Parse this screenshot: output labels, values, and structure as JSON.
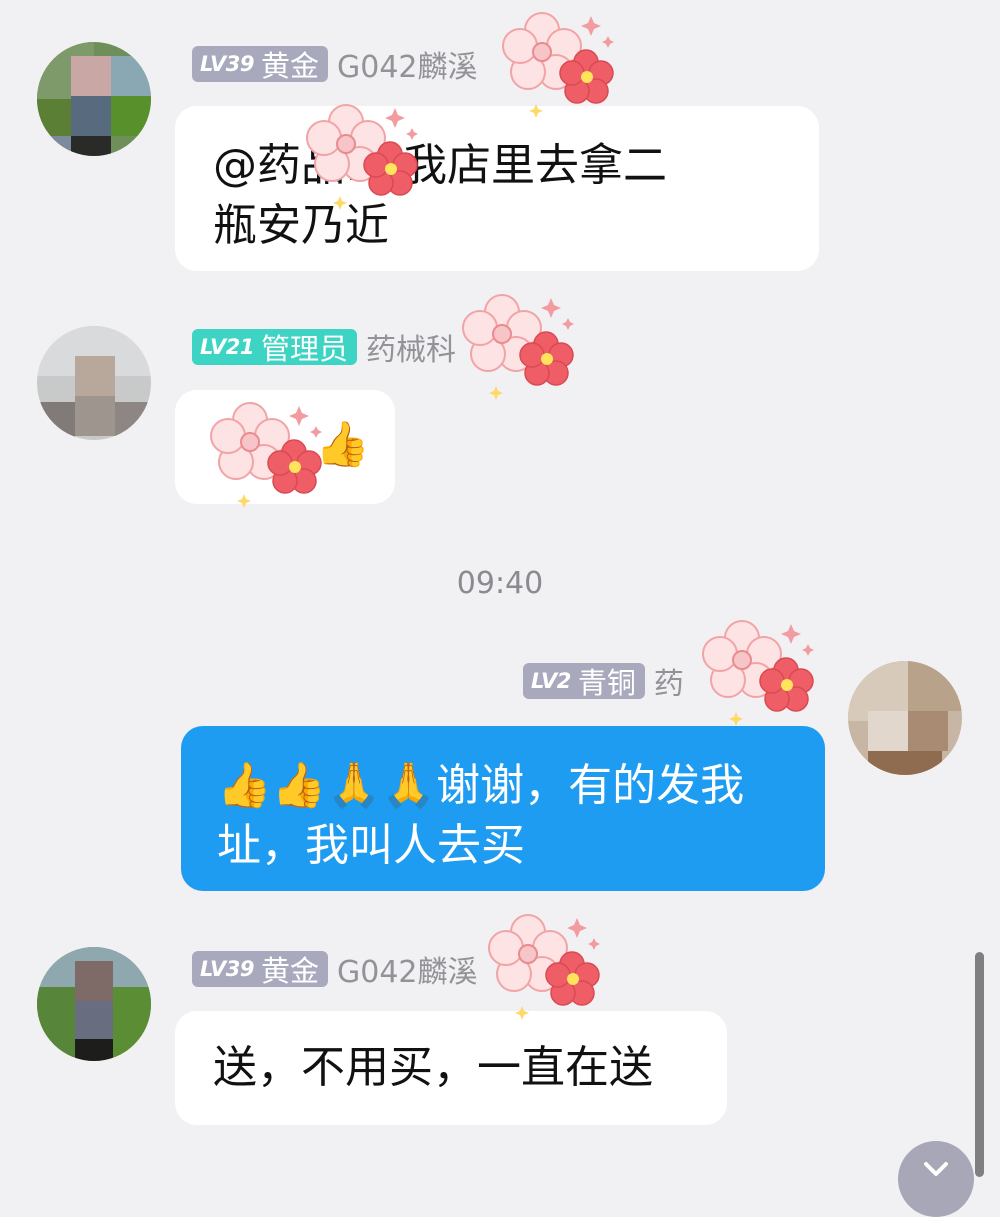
{
  "messages": [
    {
      "level": "LV39",
      "rank": "黄金",
      "sender": "G042麟溪",
      "lines": [
        "@药品… 我店里去拿二",
        "瓶安乃近"
      ]
    },
    {
      "level": "LV21",
      "rank": "管理员",
      "sender": "药械科",
      "lines": [
        "👍"
      ]
    },
    {
      "time": "09:40"
    },
    {
      "level": "LV2",
      "rank": "青铜",
      "sender": "药",
      "lines": [
        "👍👍🙏🙏谢谢，有的发我",
        "址，我叫人去买"
      ]
    },
    {
      "level": "LV39",
      "rank": "黄金",
      "sender": "G042麟溪",
      "lines": [
        "送，不用买，一直在送"
      ]
    }
  ],
  "scroll_button_icon": "chevron-down-icon",
  "colors": {
    "background": "#f1f1f3",
    "self_bubble": "#1e9cf2",
    "admin_badge": "#3ed4c3",
    "level_badge": "#a9a9be"
  }
}
